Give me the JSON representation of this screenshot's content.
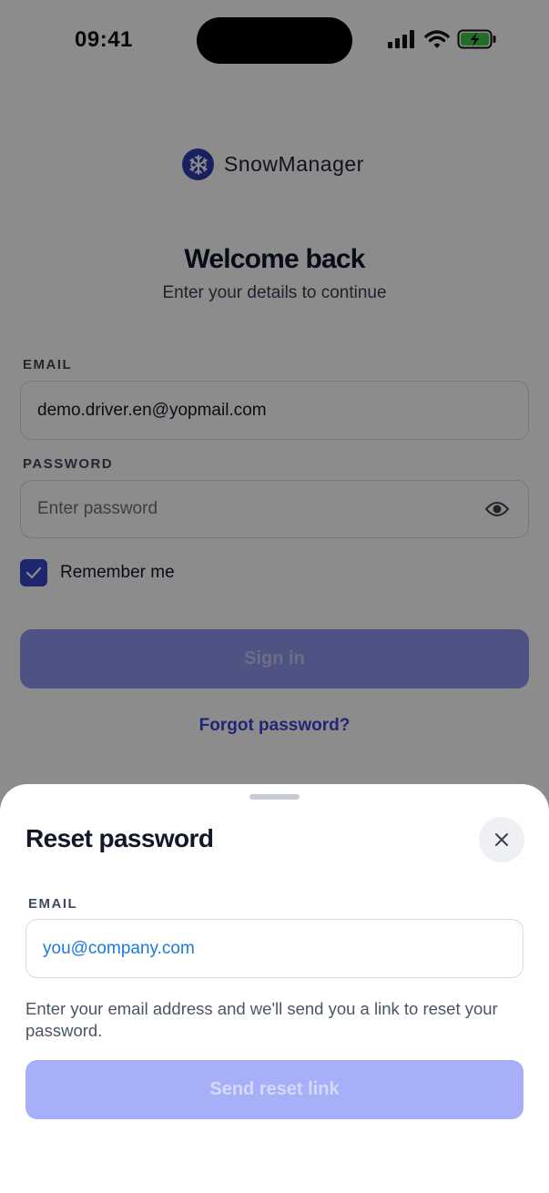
{
  "status_bar": {
    "time": "09:41"
  },
  "brand": {
    "name": "SnowManager"
  },
  "login": {
    "title": "Welcome back",
    "subtitle": "Enter your details to continue",
    "email_label": "EMAIL",
    "email_value": "demo.driver.en@yopmail.com",
    "password_label": "PASSWORD",
    "password_placeholder": "Enter password",
    "remember_label": "Remember me",
    "remember_checked": true,
    "signin_label": "Sign in",
    "forgot_label": "Forgot password?"
  },
  "reset_sheet": {
    "title": "Reset password",
    "email_label": "EMAIL",
    "email_placeholder": "you@company.com",
    "help_text": "Enter your email address and we'll send you a link to reset your password.",
    "send_label": "Send reset link"
  },
  "colors": {
    "accent": "#3b46c9",
    "link": "#3a45d8",
    "placeholder_blue": "#1a7ad9",
    "button_disabled": "#a6aff7",
    "overlay": "rgba(0,0,0,0.45)"
  }
}
